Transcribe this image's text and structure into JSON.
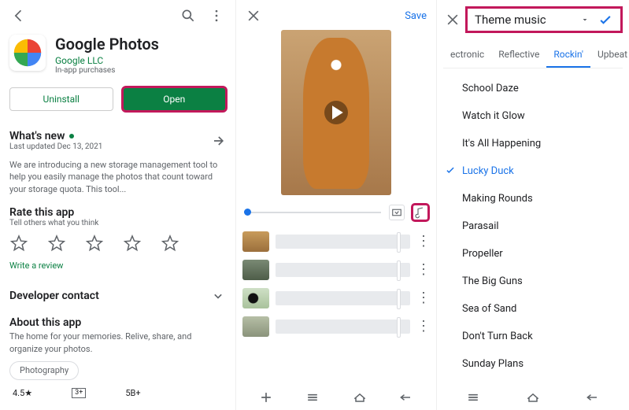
{
  "pane1": {
    "app_title": "Google Photos",
    "publisher": "Google LLC",
    "iap": "In-app purchases",
    "uninstall": "Uninstall",
    "open": "Open",
    "whats_new_title": "What's new",
    "last_updated": "Last updated Dec 13, 2021",
    "whats_new_body": "We are introducing a new storage management tool to help you easily manage the photos that count toward your storage quota. This tool...",
    "rate_title": "Rate this app",
    "rate_sub": "Tell others what you think",
    "write_review": "Write a review",
    "dev_contact": "Developer contact",
    "about_title": "About this app",
    "about_body": "The home for your memories. Relive, share, and organize your photos.",
    "tag": "Photography",
    "rating": "4.5★",
    "age": "3+",
    "downloads": "5B+"
  },
  "pane2": {
    "save": "Save"
  },
  "pane3": {
    "dropdown_label": "Theme music",
    "tabs": [
      "ectronic",
      "Reflective",
      "Rockin'",
      "Upbeat"
    ],
    "active_tab": "Rockin'",
    "songs": [
      "School Daze",
      "Watch it Glow",
      "It's All Happening",
      "Lucky Duck",
      "Making Rounds",
      "Parasail",
      "Propeller",
      "The Big Guns",
      "Sea of Sand",
      "Don't Turn Back",
      "Sunday Plans"
    ],
    "active_song": "Lucky Duck"
  }
}
